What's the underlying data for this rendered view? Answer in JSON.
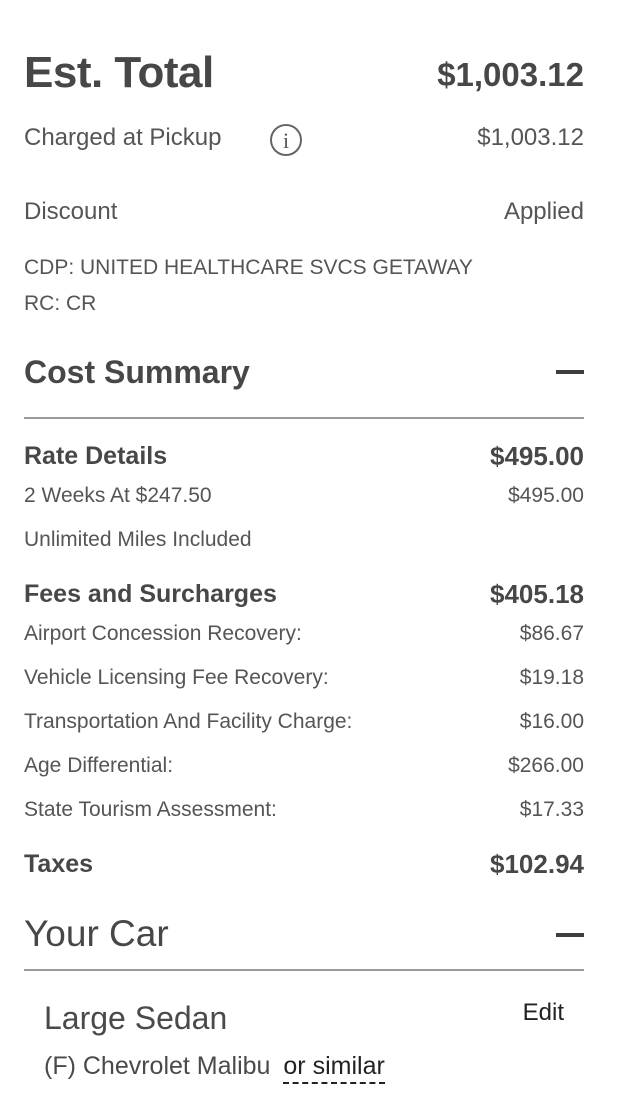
{
  "estimate": {
    "title": "Est. Total",
    "total": "$1,003.12",
    "charged_label": "Charged at Pickup",
    "charged_amount": "$1,003.12",
    "info_glyph": "i",
    "discount_label": "Discount",
    "discount_value": "Applied",
    "cdp_line": "CDP: UNITED HEALTHCARE SVCS GETAWAY",
    "rc_line": "RC: CR"
  },
  "cost_summary": {
    "title": "Cost Summary",
    "rate_details": {
      "label": "Rate Details",
      "amount": "$495.00",
      "items": [
        {
          "label": "2 Weeks At $247.50",
          "amount": "$495.00"
        },
        {
          "label": "Unlimited Miles Included",
          "amount": ""
        }
      ]
    },
    "fees": {
      "label": "Fees and Surcharges",
      "amount": "$405.18",
      "items": [
        {
          "label": "Airport Concession Recovery:",
          "amount": "$86.67"
        },
        {
          "label": "Vehicle Licensing Fee Recovery:",
          "amount": "$19.18"
        },
        {
          "label": "Transportation And Facility Charge:",
          "amount": "$16.00"
        },
        {
          "label": "Age Differential:",
          "amount": "$266.00"
        },
        {
          "label": "State Tourism Assessment:",
          "amount": "$17.33"
        }
      ]
    },
    "taxes": {
      "label": "Taxes",
      "amount": "$102.94"
    }
  },
  "your_car": {
    "title": "Your Car",
    "car_class": "Large Sedan",
    "edit_label": "Edit",
    "model": "(F) Chevrolet Malibu",
    "or_similar": "or similar"
  },
  "icons": {
    "info": "info-circle-icon",
    "collapse": "minus-icon"
  }
}
